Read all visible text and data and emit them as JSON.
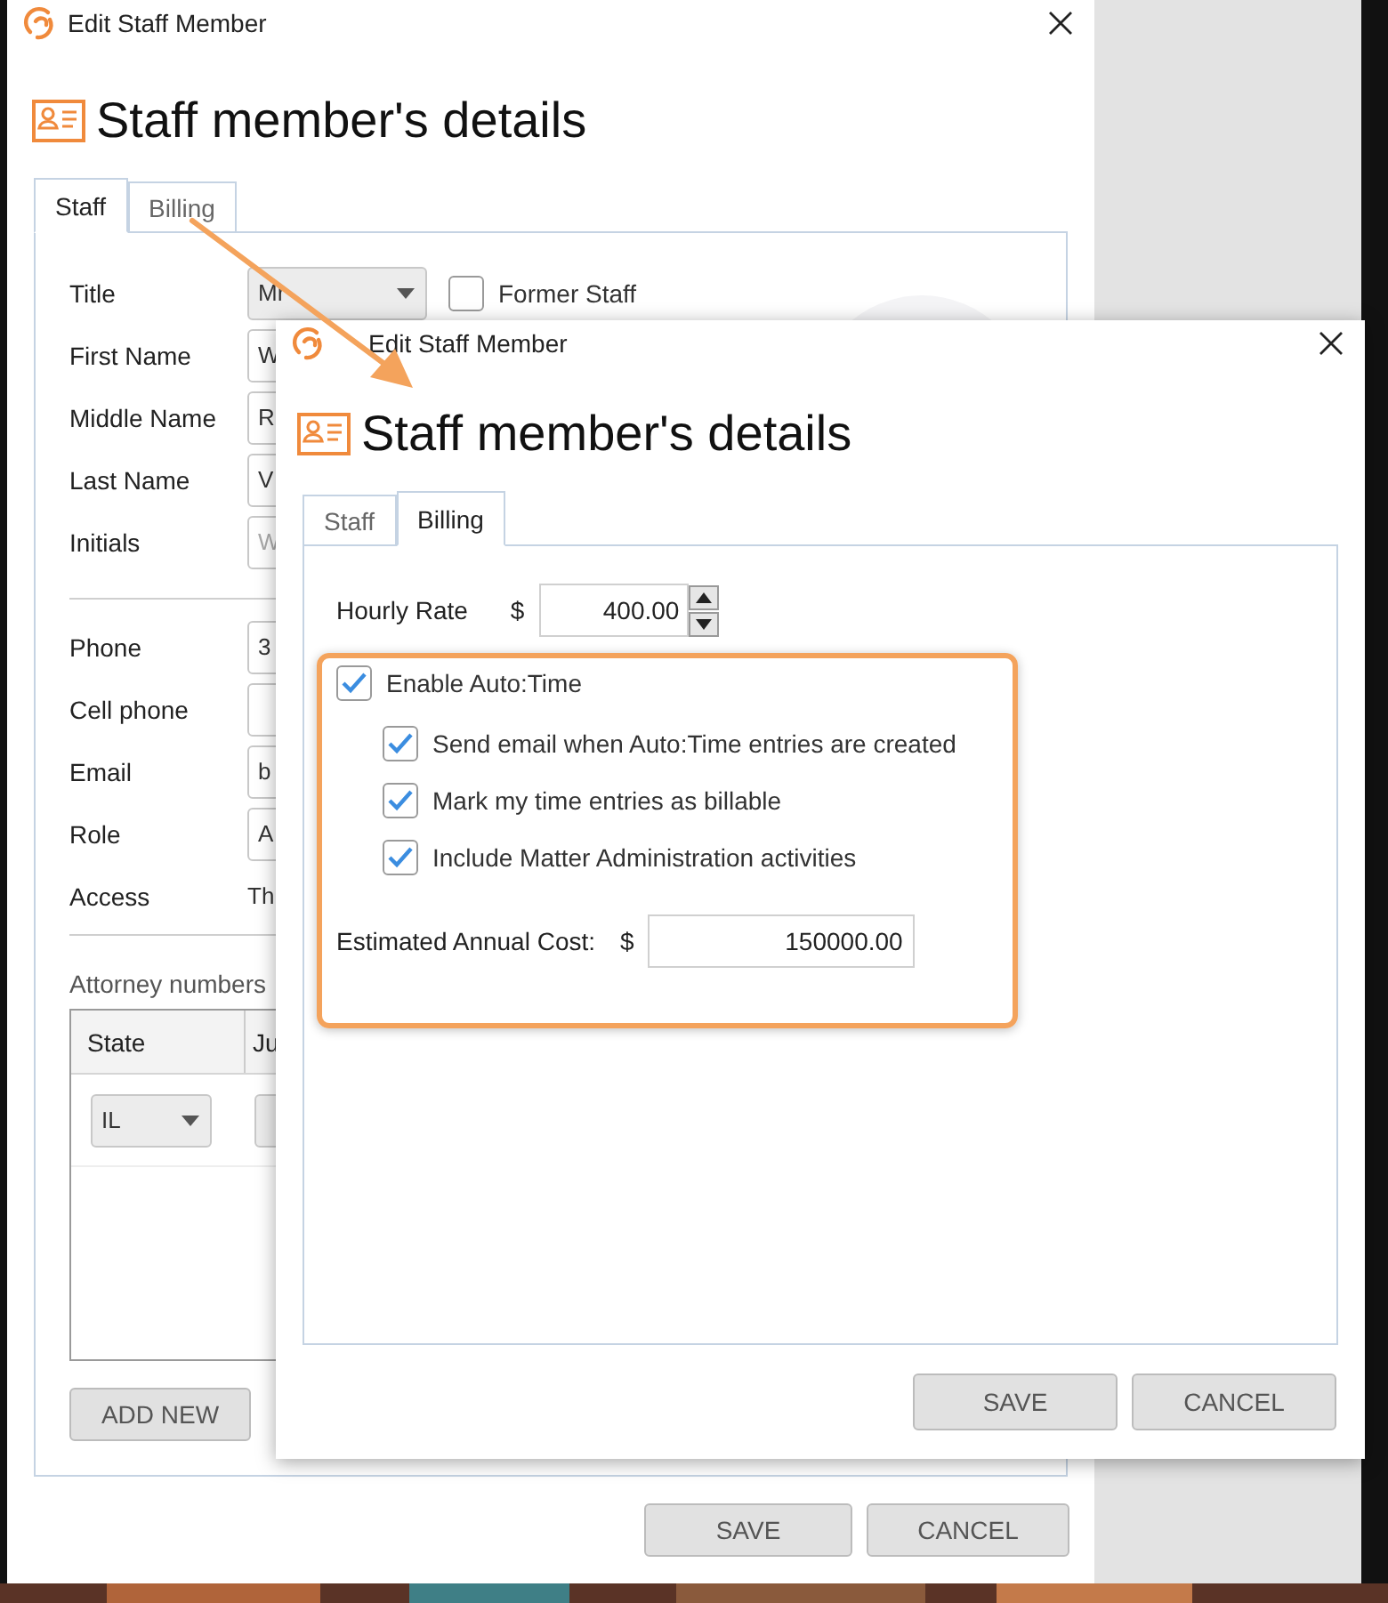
{
  "back_window": {
    "title": "Edit Staff Member",
    "heading": "Staff member's details",
    "tabs": [
      {
        "label": "Staff",
        "selected": true
      },
      {
        "label": "Billing",
        "selected": false
      }
    ],
    "name_fields": [
      {
        "label": "Title",
        "kind": "dropdown",
        "value": "Mr"
      },
      {
        "label": "First Name",
        "kind": "text",
        "value": "W"
      },
      {
        "label": "Middle Name",
        "kind": "text",
        "value": "R"
      },
      {
        "label": "Last Name",
        "kind": "text",
        "value": "V"
      },
      {
        "label": "Initials",
        "kind": "text",
        "placeholder": "W"
      }
    ],
    "former_staff": {
      "label": "Former Staff",
      "checked": false
    },
    "contact_fields": [
      {
        "label": "Phone",
        "kind": "text",
        "value": "3"
      },
      {
        "label": "Cell phone",
        "kind": "text"
      },
      {
        "label": "Email",
        "kind": "text",
        "value": "b"
      },
      {
        "label": "Role",
        "kind": "text",
        "value": "A"
      },
      {
        "label": "Access",
        "kind": "static",
        "value": "Th"
      }
    ],
    "attorney_numbers": {
      "title": "Attorney numbers",
      "columns": [
        "State",
        "Ju"
      ],
      "rows": [
        {
          "state": "IL"
        }
      ]
    },
    "add_button": "ADD NEW",
    "buttons": [
      "SAVE",
      "CANCEL"
    ]
  },
  "front_window": {
    "title": "Edit Staff Member",
    "heading": "Staff member's details",
    "tabs": [
      {
        "label": "Staff",
        "selected": false
      },
      {
        "label": "Billing",
        "selected": true
      }
    ],
    "hourly_rate": {
      "label": "Hourly Rate",
      "currency": "$",
      "value": "400.00"
    },
    "auto_time": {
      "label": "Enable Auto:Time",
      "checked": true,
      "options": [
        {
          "label": "Send email when Auto:Time entries are created",
          "checked": true
        },
        {
          "label": "Mark my time entries as billable",
          "checked": true
        },
        {
          "label": "Include Matter Administration activities",
          "checked": true
        }
      ]
    },
    "estimated_cost": {
      "label": "Estimated Annual Cost:",
      "currency": "$",
      "value": "150000.00"
    },
    "buttons": [
      "SAVE",
      "CANCEL"
    ]
  }
}
